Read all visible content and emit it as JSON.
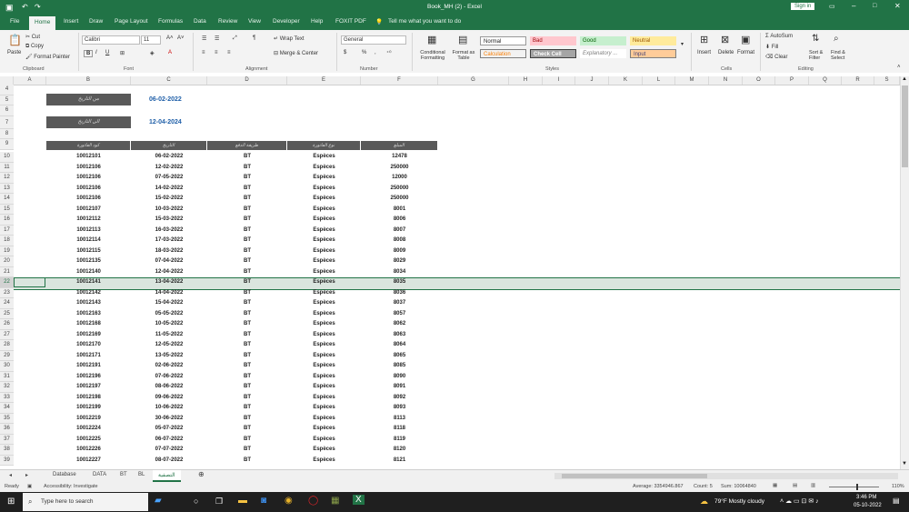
{
  "app": {
    "title": "Book_MH (2) - Excel",
    "sign_in": "Sign in"
  },
  "ribbon_tabs": [
    "File",
    "Home",
    "Insert",
    "Draw",
    "Page Layout",
    "Formulas",
    "Data",
    "Review",
    "View",
    "Developer",
    "Help",
    "FOXIT PDF"
  ],
  "tell_me": "Tell me what you want to do",
  "ribbon": {
    "clipboard": {
      "paste": "Paste",
      "cut": "Cut",
      "copy": "Copy",
      "format_painter": "Format Painter",
      "label": "Clipboard"
    },
    "font": {
      "name": "Calibri",
      "size": "11",
      "label": "Font"
    },
    "alignment": {
      "wrap": "Wrap Text",
      "merge": "Merge & Center",
      "label": "Alignment"
    },
    "number": {
      "format": "General",
      "label": "Number"
    },
    "styles": {
      "conditional": "Conditional Formatting",
      "format_table": "Format as Table",
      "normal": "Normal",
      "bad": "Bad",
      "good": "Good",
      "neutral": "Neutral",
      "calculation": "Calculation",
      "check_cell": "Check Cell",
      "explanatory": "Explanatory ...",
      "input": "Input",
      "label": "Styles"
    },
    "cells": {
      "insert": "Insert",
      "delete": "Delete",
      "format": "Format",
      "label": "Cells"
    },
    "editing": {
      "autosum": "AutoSum",
      "fill": "Fill",
      "clear": "Clear",
      "sort": "Sort & Filter",
      "find": "Find & Select",
      "label": "Editing"
    }
  },
  "columns": [
    "A",
    "B",
    "C",
    "D",
    "E",
    "F",
    "G",
    "H",
    "I",
    "J",
    "K",
    "L",
    "M",
    "N",
    "O",
    "P",
    "Q",
    "R",
    "S"
  ],
  "filters": {
    "from_label": "من التاريخ",
    "from_value": "06-02-2022",
    "to_label": "الى التاريخ",
    "to_value": "12-04-2024"
  },
  "table_headers": [
    "كود الفاتورة",
    "التاريخ",
    "طريقة الدفع",
    "نوع الفاتورة",
    "المبلغ"
  ],
  "rows": [
    {
      "r": "10",
      "code": "10012101",
      "date": "06-02-2022",
      "pay": "BT",
      "type": "Espèces",
      "amt": "12478"
    },
    {
      "r": "11",
      "code": "10012106",
      "date": "12-02-2022",
      "pay": "BT",
      "type": "Espèces",
      "amt": "250000"
    },
    {
      "r": "12",
      "code": "10012106",
      "date": "07-05-2022",
      "pay": "BT",
      "type": "Espèces",
      "amt": "12000"
    },
    {
      "r": "13",
      "code": "10012106",
      "date": "14-02-2022",
      "pay": "BT",
      "type": "Espèces",
      "amt": "250000"
    },
    {
      "r": "14",
      "code": "10012106",
      "date": "15-02-2022",
      "pay": "BT",
      "type": "Espèces",
      "amt": "250000"
    },
    {
      "r": "15",
      "code": "10012107",
      "date": "10-03-2022",
      "pay": "BT",
      "type": "Espèces",
      "amt": "8001"
    },
    {
      "r": "16",
      "code": "10012112",
      "date": "15-03-2022",
      "pay": "BT",
      "type": "Espèces",
      "amt": "8006"
    },
    {
      "r": "17",
      "code": "10012113",
      "date": "16-03-2022",
      "pay": "BT",
      "type": "Espèces",
      "amt": "8007"
    },
    {
      "r": "18",
      "code": "10012114",
      "date": "17-03-2022",
      "pay": "BT",
      "type": "Espèces",
      "amt": "8008"
    },
    {
      "r": "19",
      "code": "10012115",
      "date": "18-03-2022",
      "pay": "BT",
      "type": "Espèces",
      "amt": "8009"
    },
    {
      "r": "20",
      "code": "10012135",
      "date": "07-04-2022",
      "pay": "BT",
      "type": "Espèces",
      "amt": "8029"
    },
    {
      "r": "21",
      "code": "10012140",
      "date": "12-04-2022",
      "pay": "BT",
      "type": "Espèces",
      "amt": "8034"
    },
    {
      "r": "22",
      "code": "10012141",
      "date": "13-04-2022",
      "pay": "BT",
      "type": "Espèces",
      "amt": "8035"
    },
    {
      "r": "23",
      "code": "10012142",
      "date": "14-04-2022",
      "pay": "BT",
      "type": "Espèces",
      "amt": "8036"
    },
    {
      "r": "24",
      "code": "10012143",
      "date": "15-04-2022",
      "pay": "BT",
      "type": "Espèces",
      "amt": "8037"
    },
    {
      "r": "25",
      "code": "10012163",
      "date": "05-05-2022",
      "pay": "BT",
      "type": "Espèces",
      "amt": "8057"
    },
    {
      "r": "26",
      "code": "10012168",
      "date": "10-05-2022",
      "pay": "BT",
      "type": "Espèces",
      "amt": "8062"
    },
    {
      "r": "27",
      "code": "10012169",
      "date": "11-05-2022",
      "pay": "BT",
      "type": "Espèces",
      "amt": "8063"
    },
    {
      "r": "28",
      "code": "10012170",
      "date": "12-05-2022",
      "pay": "BT",
      "type": "Espèces",
      "amt": "8064"
    },
    {
      "r": "29",
      "code": "10012171",
      "date": "13-05-2022",
      "pay": "BT",
      "type": "Espèces",
      "amt": "8065"
    },
    {
      "r": "30",
      "code": "10012191",
      "date": "02-06-2022",
      "pay": "BT",
      "type": "Espèces",
      "amt": "8085"
    },
    {
      "r": "31",
      "code": "10012196",
      "date": "07-06-2022",
      "pay": "BT",
      "type": "Espèces",
      "amt": "8090"
    },
    {
      "r": "32",
      "code": "10012197",
      "date": "08-06-2022",
      "pay": "BT",
      "type": "Espèces",
      "amt": "8091"
    },
    {
      "r": "33",
      "code": "10012198",
      "date": "09-06-2022",
      "pay": "BT",
      "type": "Espèces",
      "amt": "8092"
    },
    {
      "r": "34",
      "code": "10012199",
      "date": "10-06-2022",
      "pay": "BT",
      "type": "Espèces",
      "amt": "8093"
    },
    {
      "r": "35",
      "code": "10012219",
      "date": "30-06-2022",
      "pay": "BT",
      "type": "Espèces",
      "amt": "8113"
    },
    {
      "r": "36",
      "code": "10012224",
      "date": "05-07-2022",
      "pay": "BT",
      "type": "Espèces",
      "amt": "8118"
    },
    {
      "r": "37",
      "code": "10012225",
      "date": "06-07-2022",
      "pay": "BT",
      "type": "Espèces",
      "amt": "8119"
    },
    {
      "r": "38",
      "code": "10012226",
      "date": "07-07-2022",
      "pay": "BT",
      "type": "Espèces",
      "amt": "8120"
    },
    {
      "r": "39",
      "code": "10012227",
      "date": "08-07-2022",
      "pay": "BT",
      "type": "Espèces",
      "amt": "8121"
    }
  ],
  "empty_rows": [
    "4",
    "5",
    "6",
    "7",
    "8",
    "9"
  ],
  "sheet_tabs": [
    "Database",
    "DATA",
    "BT",
    "BL",
    "التصفية"
  ],
  "active_sheet": "التصفية",
  "status": {
    "ready": "Ready",
    "accessibility": "Accessibility: Investigate",
    "average": "Average: 3354946.867",
    "count": "Count: 5",
    "sum": "Sum: 10064840",
    "zoom": "110%"
  },
  "taskbar": {
    "search": "Type here to search",
    "weather": "79°F  Mostly cloudy",
    "time": "3:46 PM",
    "date": "05-10-2022"
  },
  "colors": {
    "excel_green": "#217346",
    "header_gray": "#595959",
    "date_blue": "#1f5fa8"
  }
}
